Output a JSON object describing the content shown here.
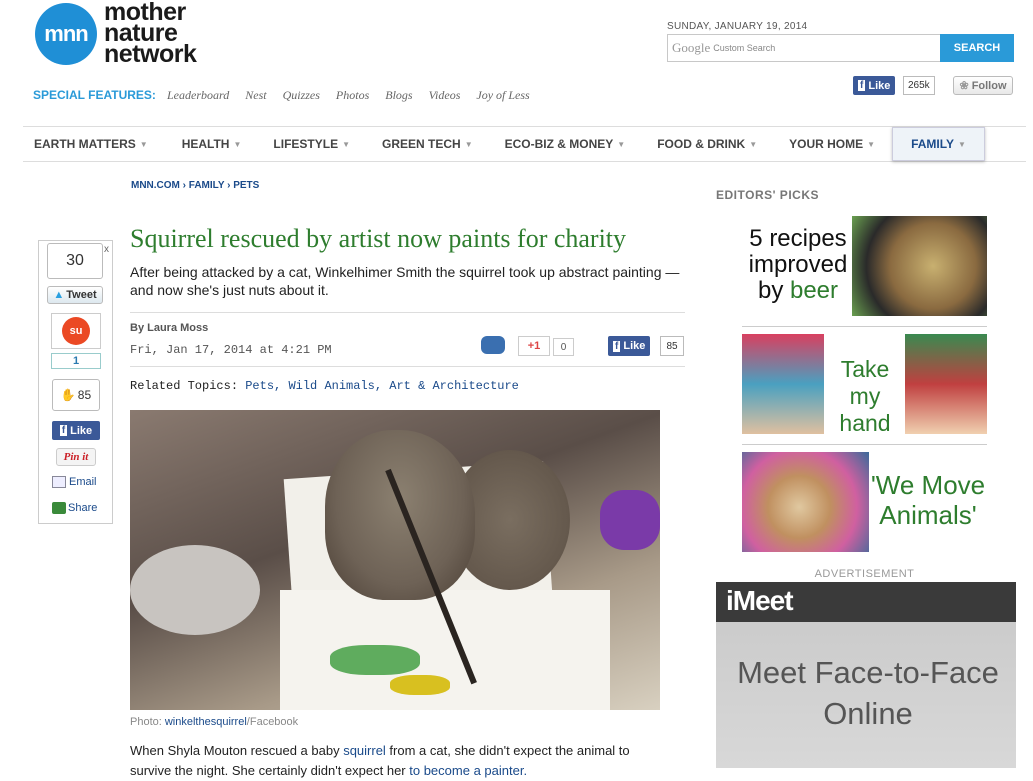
{
  "header": {
    "logo_mark": "mnn",
    "logo_text_1": "mother",
    "logo_text_2": "nature",
    "logo_text_3": "network",
    "date": "SUNDAY, JANUARY 19, 2014",
    "search_google": "Google",
    "search_placeholder": "Custom Search",
    "search_button": "SEARCH",
    "special_label": "SPECIAL FEATURES:",
    "special_links": [
      "Leaderboard",
      "Nest",
      "Quizzes",
      "Photos",
      "Blogs",
      "Videos",
      "Joy of Less"
    ],
    "fb_like": "Like",
    "fb_count": "265k",
    "follow": "Follow"
  },
  "nav": {
    "items": [
      "EARTH MATTERS",
      "HEALTH",
      "LIFESTYLE",
      "GREEN TECH",
      "ECO-BIZ & MONEY",
      "FOOD & DRINK",
      "YOUR HOME",
      "FAMILY"
    ],
    "active": "FAMILY"
  },
  "breadcrumb": "MNN.COM  › FAMILY  › PETS",
  "article": {
    "headline": "Squirrel rescued by artist now paints for charity",
    "dek": "After being attacked by a cat, Winkelhimer Smith the squirrel took up abstract painting — and now she's just nuts about it.",
    "byline": "By Laura Moss",
    "date": "Fri, Jan 17, 2014 at 4:21 PM",
    "gplus": "+1",
    "gplus_count": "0",
    "fb_like": "Like",
    "fb_count": "85",
    "related_label": "Related Topics:",
    "related_links": "Pets, Wild Animals, Art & Architecture",
    "caption_prefix": "Photo: ",
    "caption_source": "winkelthesquirrel",
    "caption_suffix": "/Facebook",
    "body_1": "When Shyla Mouton rescued a baby ",
    "body_link_1": "squirrel",
    "body_2": " from a cat, she didn't expect the animal to survive the night. She certainly didn't expect her ",
    "body_link_2": "to become a painter."
  },
  "share_rail": {
    "close": "x",
    "tweet_count": "30",
    "tweet": "Tweet",
    "stumble_count": "1",
    "fb_count": "85",
    "fb_like": "Like",
    "pinit": "Pin it",
    "email": "Email",
    "share": "Share"
  },
  "sidebar": {
    "picks_title": "EDITORS' PICKS",
    "pick1_line1": "5 recipes",
    "pick1_line2": "improved",
    "pick1_by": "by ",
    "pick1_green": "beer",
    "pick2_text_1": "Take my",
    "pick2_text_2": "hand",
    "pick3_text_1": "'We Move",
    "pick3_text_2": "Animals'",
    "ad_label": "ADVERTISEMENT",
    "ad_logo": "iMeet",
    "ad_line1": "Meet Face-to-Face",
    "ad_line2": "Online"
  },
  "colors": {
    "brand_blue": "#1f8fd6",
    "headline_green": "#2e7d2e",
    "link_blue": "#1a4a8a",
    "facebook": "#3b5998"
  }
}
